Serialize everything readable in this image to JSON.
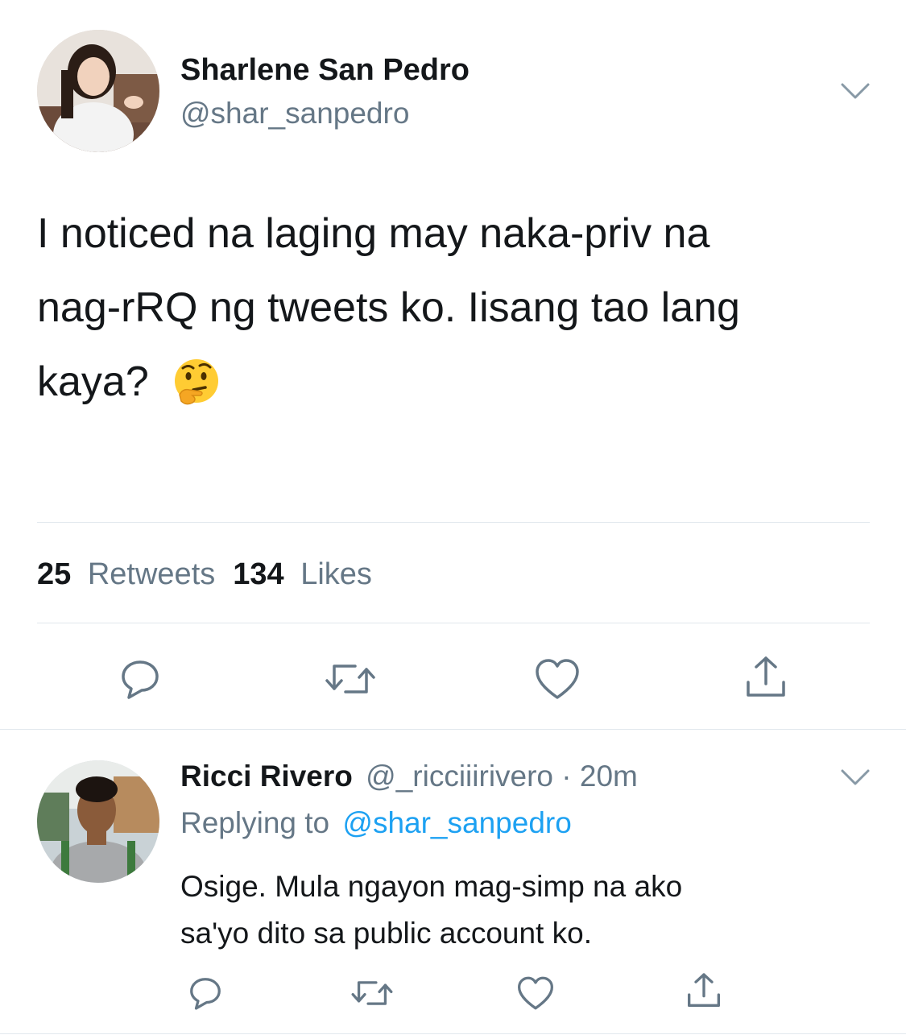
{
  "main_tweet": {
    "author_name": "Sharlene San Pedro",
    "author_handle": "@shar_sanpedro",
    "text_line1": "I noticed na laging may naka-priv na",
    "text_line2": "nag-rRQ ng tweets ko. Iisang tao lang",
    "text_line3": "kaya?",
    "emoji_icon": "thinking-face-icon",
    "retweet_count": "25",
    "retweet_label": "Retweets",
    "like_count": "134",
    "like_label": "Likes"
  },
  "reply": {
    "author_name": "Ricci Rivero",
    "author_handle": "@_ricciiirivero",
    "separator": "·",
    "time": "20m",
    "replying_to_label": "Replying to",
    "replying_to_handle": "@shar_sanpedro",
    "text_line1": "Osige. Mula ngayon mag-simp na ako",
    "text_line2": "sa'yo dito sa public account ko."
  },
  "colors": {
    "text": "#14171a",
    "muted": "#657786",
    "link": "#1da1f2",
    "icon": "#657786",
    "divider": "#e1e8ed"
  }
}
